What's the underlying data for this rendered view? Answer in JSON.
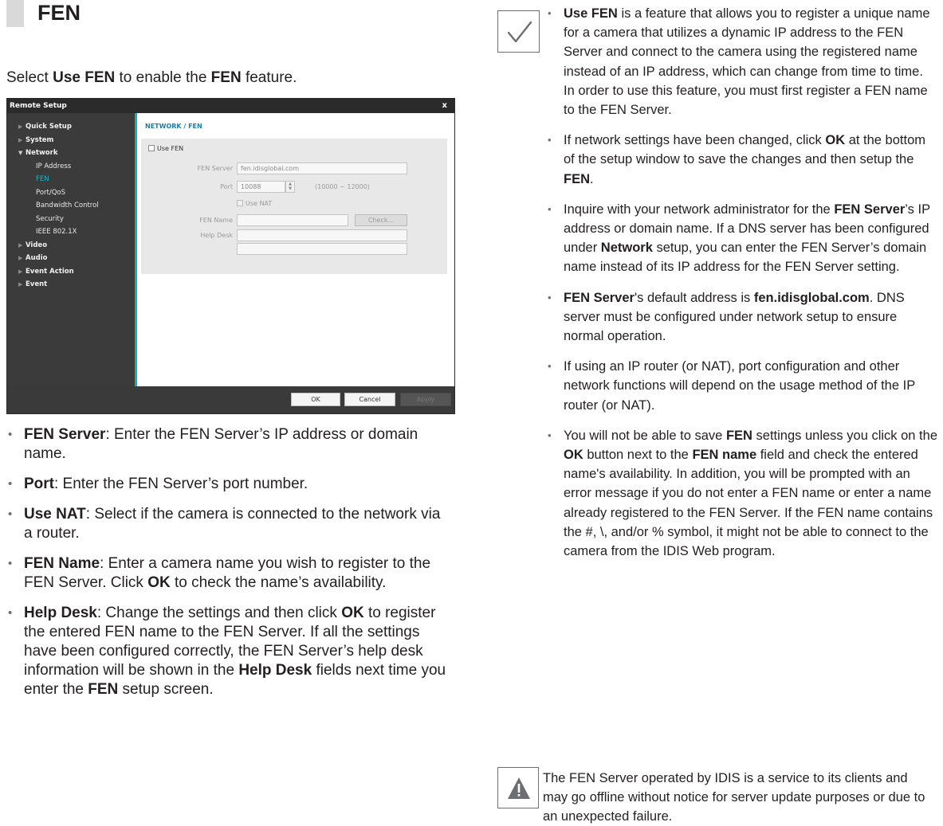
{
  "heading": "FEN",
  "intro": {
    "pre": "Select ",
    "b1": "Use FEN",
    "mid": " to enable the ",
    "b2": "FEN",
    "post": " feature."
  },
  "dialog": {
    "title": "Remote Setup",
    "close": "x",
    "tree": [
      {
        "label": "Quick Setup",
        "type": "cat",
        "icon": "triangle-right-icon"
      },
      {
        "label": "System",
        "type": "cat",
        "icon": "triangle-right-icon"
      },
      {
        "label": "Network",
        "type": "cat",
        "icon": "triangle-down-icon"
      },
      {
        "label": "IP Address",
        "type": "sub"
      },
      {
        "label": "FEN",
        "type": "sub",
        "selected": true
      },
      {
        "label": "Port/QoS",
        "type": "sub"
      },
      {
        "label": "Bandwidth Control",
        "type": "sub"
      },
      {
        "label": "Security",
        "type": "sub"
      },
      {
        "label": "IEEE 802.1X",
        "type": "sub"
      },
      {
        "label": "Video",
        "type": "cat",
        "icon": "triangle-right-icon"
      },
      {
        "label": "Audio",
        "type": "cat",
        "icon": "triangle-right-icon"
      },
      {
        "label": "Event Action",
        "type": "cat",
        "icon": "triangle-right-icon"
      },
      {
        "label": "Event",
        "type": "cat",
        "icon": "triangle-right-icon"
      }
    ],
    "section_title": "NETWORK / FEN",
    "use_fen_label": "Use FEN",
    "use_fen_checked": false,
    "fen_server_label": "FEN Server",
    "fen_server_value": "fen.idisglobal.com",
    "port_label": "Port",
    "port_value": "10088",
    "port_range": "(10000 ~ 12000)",
    "use_nat_label": "Use NAT",
    "fen_name_label": "FEN Name",
    "fen_name_value": "",
    "check_button": "Check...",
    "help_desk_label": "Help Desk",
    "help_desk_value_1": "",
    "help_desk_value_2": "",
    "ok_button": "OK",
    "cancel_button": "Cancel",
    "apply_button": "Apply",
    "accent_color": "#1aa9c0"
  },
  "left_list": [
    {
      "b": "FEN Server",
      "t": ": Enter the FEN Server’s IP address or domain name."
    },
    {
      "b": "Port",
      "t": ": Enter the FEN Server’s port number."
    },
    {
      "b": "Use NAT",
      "t": ": Select if the camera is connected to the network via a router."
    },
    {
      "b": "FEN Name",
      "t1": ": Enter a camera name you wish to register to the FEN Server. Click ",
      "b2": "OK",
      "t2": " to check the name’s availability."
    },
    {
      "b": "Help Desk",
      "t1": ": Change the settings and then click ",
      "b2": "OK",
      "t2": " to register the entered FEN name to the FEN Server. If all the settings have been configured correctly, the FEN Server’s help desk information will be shown in the ",
      "b3": "Help Desk",
      "t3": " fields next time you enter the ",
      "b4": "FEN",
      "t4": " setup screen."
    }
  ],
  "notes": [
    {
      "b1": "Use FEN",
      "t1": " is a feature that allows you to register a unique name for a camera that utilizes a dynamic IP address to the FEN Server and connect to the camera using the registered name instead of an IP address, which can change from time to time. In order to use this feature, you must first register a FEN name to the FEN Server."
    },
    {
      "t1": "If network settings have been changed, click ",
      "b1": "OK",
      "t2": " at the bottom of the setup window to save the changes and then setup the ",
      "b2": "FEN",
      "t3": "."
    },
    {
      "t1": "Inquire with your network administrator for the ",
      "b1": "FEN Server",
      "t2": "’s IP address or domain name. If a DNS server has been configured under ",
      "b2": "Network",
      "t3": " setup, you can enter the FEN Server’s domain name instead of its IP address for the FEN Server setting."
    },
    {
      "b1": "FEN Server",
      "t1": "'s default address is ",
      "b2": "fen.idisglobal.com",
      "t2": ". DNS server must be configured under network setup to ensure normal operation."
    },
    {
      "t1": "If using an IP router (or NAT), port configuration and other network functions will depend on the usage method of the IP router (or NAT)."
    },
    {
      "t1": "You will not be able to save ",
      "b1": "FEN",
      "t2": " settings unless you click on the ",
      "b2": "OK",
      "t3": " button next to the ",
      "b3": "FEN name",
      "t4": " field and check the entered name's availability. In addition, you will be prompted with an error message if you do not enter a FEN name or enter a name already registered to the FEN Server. If the FEN name contains the #, \\, and/or % symbol, it might not be able to connect to the camera from the IDIS Web program."
    }
  ],
  "note_icon": "checkmark-icon",
  "warning_icon": "warning-triangle-icon",
  "warning": "The FEN Server operated by IDIS is a service to its clients and may go offline without notice for server update purposes or due to an unexpected failure."
}
